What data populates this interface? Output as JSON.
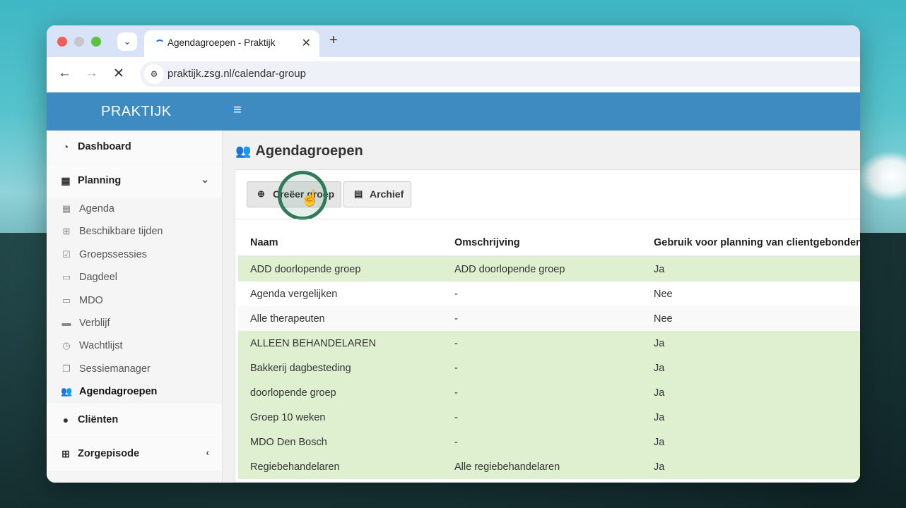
{
  "browser": {
    "tab_title": "Agendagroepen - Praktijk",
    "tab_close": "✕",
    "new_tab": "+",
    "url": "praktijk.zsg.nl/calendar-group",
    "back": "←",
    "forward": "→",
    "stop": "✕"
  },
  "app": {
    "logo": "PRAKTIJK",
    "menu_icon": "≡"
  },
  "sidebar": {
    "main_items": [
      {
        "label": "Dashboard",
        "icon": "dashboard-icon",
        "glyph": "◔"
      },
      {
        "label": "Planning",
        "icon": "calendar-icon",
        "glyph": "▦",
        "caret": "⌄"
      },
      {
        "label": "Cliënten",
        "icon": "user-icon",
        "glyph": "●"
      },
      {
        "label": "Zorgepisode",
        "icon": "medkit-icon",
        "glyph": "⊞",
        "caret": "‹"
      }
    ],
    "sub_items": [
      {
        "label": "Agenda",
        "icon": "calendar-icon",
        "glyph": "▦"
      },
      {
        "label": "Beschikbare tijden",
        "icon": "calendar-plus-icon",
        "glyph": "⊞"
      },
      {
        "label": "Groepssessies",
        "icon": "calendar-check-icon",
        "glyph": "☑"
      },
      {
        "label": "Dagdeel",
        "icon": "calendar-icon",
        "glyph": "▭"
      },
      {
        "label": "MDO",
        "icon": "calendar-icon",
        "glyph": "▭"
      },
      {
        "label": "Verblijf",
        "icon": "bed-icon",
        "glyph": "▬"
      },
      {
        "label": "Wachtlijst",
        "icon": "clock-icon",
        "glyph": "◷"
      },
      {
        "label": "Sessiemanager",
        "icon": "copy-icon",
        "glyph": "❐"
      },
      {
        "label": "Agendagroepen",
        "icon": "users-icon",
        "glyph": "👥"
      }
    ]
  },
  "page": {
    "title": "Agendagroepen",
    "title_glyph": "👥",
    "create_label": "Creëer groep",
    "create_glyph": "⊕",
    "archive_label": "Archief",
    "archive_glyph": "▤",
    "cursor_glyph": "☝"
  },
  "table": {
    "columns": [
      "Naam",
      "Omschrijving",
      "Gebruik voor planning van clientgebonden af"
    ],
    "rows": [
      [
        "ADD doorlopende groep",
        "ADD doorlopende groep",
        "Ja"
      ],
      [
        "Agenda vergelijken",
        "-",
        "Nee"
      ],
      [
        "Alle therapeuten",
        "-",
        "Nee"
      ],
      [
        "ALLEEN BEHANDELAREN",
        "-",
        "Ja"
      ],
      [
        "Bakkerij dagbesteding",
        "-",
        "Ja"
      ],
      [
        "doorlopende groep",
        "-",
        "Ja"
      ],
      [
        "Groep 10 weken",
        "-",
        "Ja"
      ],
      [
        "MDO Den Bosch",
        "-",
        "Ja"
      ],
      [
        "Regiebehandelaren",
        "Alle regiebehandelaren",
        "Ja"
      ]
    ]
  },
  "colors": {
    "appbar": "#3d8bc1",
    "row_highlight": "#dff0d0",
    "cursor_ring": "#2f7a5a"
  }
}
